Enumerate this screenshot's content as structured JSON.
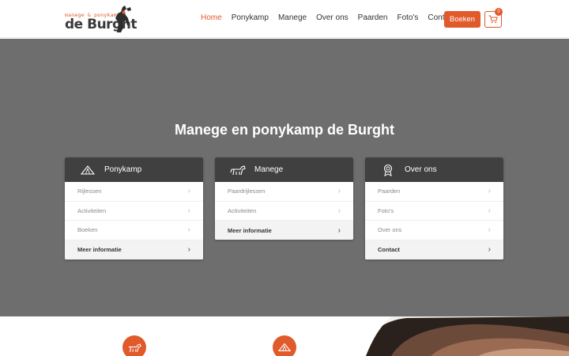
{
  "logo": {
    "top_text": "manege & ponykamp",
    "main_text": "de Burght"
  },
  "nav": {
    "items": [
      {
        "label": "Home",
        "active": true
      },
      {
        "label": "Ponykamp"
      },
      {
        "label": "Manege"
      },
      {
        "label": "Over ons"
      },
      {
        "label": "Paarden"
      },
      {
        "label": "Foto's"
      },
      {
        "label": "Contact"
      }
    ],
    "book_label": "Boeken",
    "cart_count": "0"
  },
  "hero": {
    "title": "Manege en ponykamp de Burght"
  },
  "cards": [
    {
      "title": "Ponykamp",
      "icon": "tent-icon",
      "rows": [
        "Rijlessen",
        "Activiteiten",
        "Boeken"
      ],
      "more": "Meer informatie"
    },
    {
      "title": "Manege",
      "icon": "horse-icon",
      "rows": [
        "Paardrijlessen",
        "Activiteiten"
      ],
      "more": "Meer informatie"
    },
    {
      "title": "Over ons",
      "icon": "award-icon",
      "rows": [
        "Paarden",
        "Foto's",
        "Over ons"
      ],
      "more": "Contact"
    }
  ],
  "colors": {
    "accent": "#e05a2b",
    "hero_bg": "#6e6e6e",
    "card_head": "#404040"
  }
}
